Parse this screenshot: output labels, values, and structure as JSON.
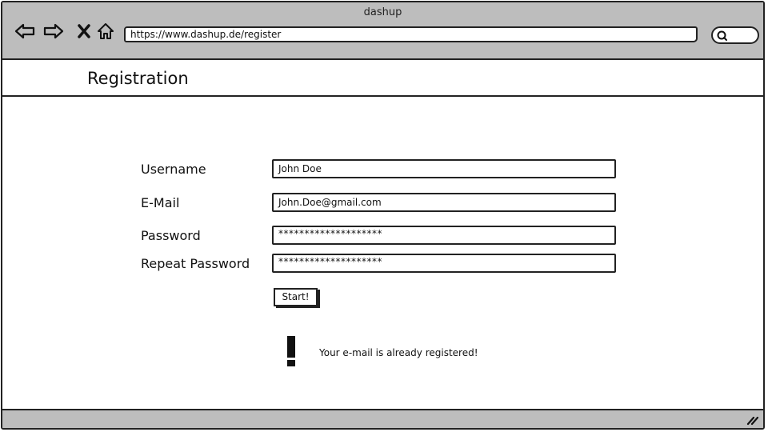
{
  "browser": {
    "title": "dashup",
    "url": "https://www.dashup.de/register",
    "nav_icons": [
      "back-arrow-icon",
      "forward-arrow-icon",
      "close-icon",
      "home-icon"
    ],
    "search_icon": "search-icon"
  },
  "page": {
    "title": "Registration"
  },
  "form": {
    "username": {
      "label": "Username",
      "value": "John Doe"
    },
    "email": {
      "label": "E-Mail",
      "value": "John.Doe@gmail.com"
    },
    "password": {
      "label": "Password",
      "value": "********************"
    },
    "repeat_password": {
      "label": "Repeat Password",
      "value": "********************"
    },
    "submit_label": "Start!"
  },
  "alert": {
    "icon": "exclamation-icon",
    "message": "Your e-mail is already registered!"
  },
  "colors": {
    "chrome": "#bdbdbd",
    "border": "#222222",
    "background": "#ffffff"
  }
}
